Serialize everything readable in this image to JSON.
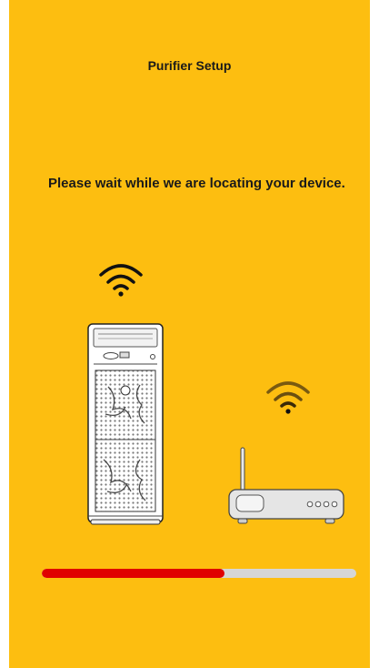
{
  "header": {
    "title": "Purifier Setup"
  },
  "main": {
    "message": "Please wait while we are locating your device.",
    "icons": {
      "purifier_signal": "wifi-icon",
      "router_signal": "wifi-icon",
      "purifier": "air-purifier-icon",
      "router": "wifi-router-icon"
    },
    "progress": {
      "value": 0.58
    }
  },
  "colors": {
    "background": "#FDBE10",
    "text": "#1a1a1a",
    "progress_fill": "#E00000",
    "progress_track": "#D6D6D6",
    "router_signal": "#7a5a10"
  }
}
